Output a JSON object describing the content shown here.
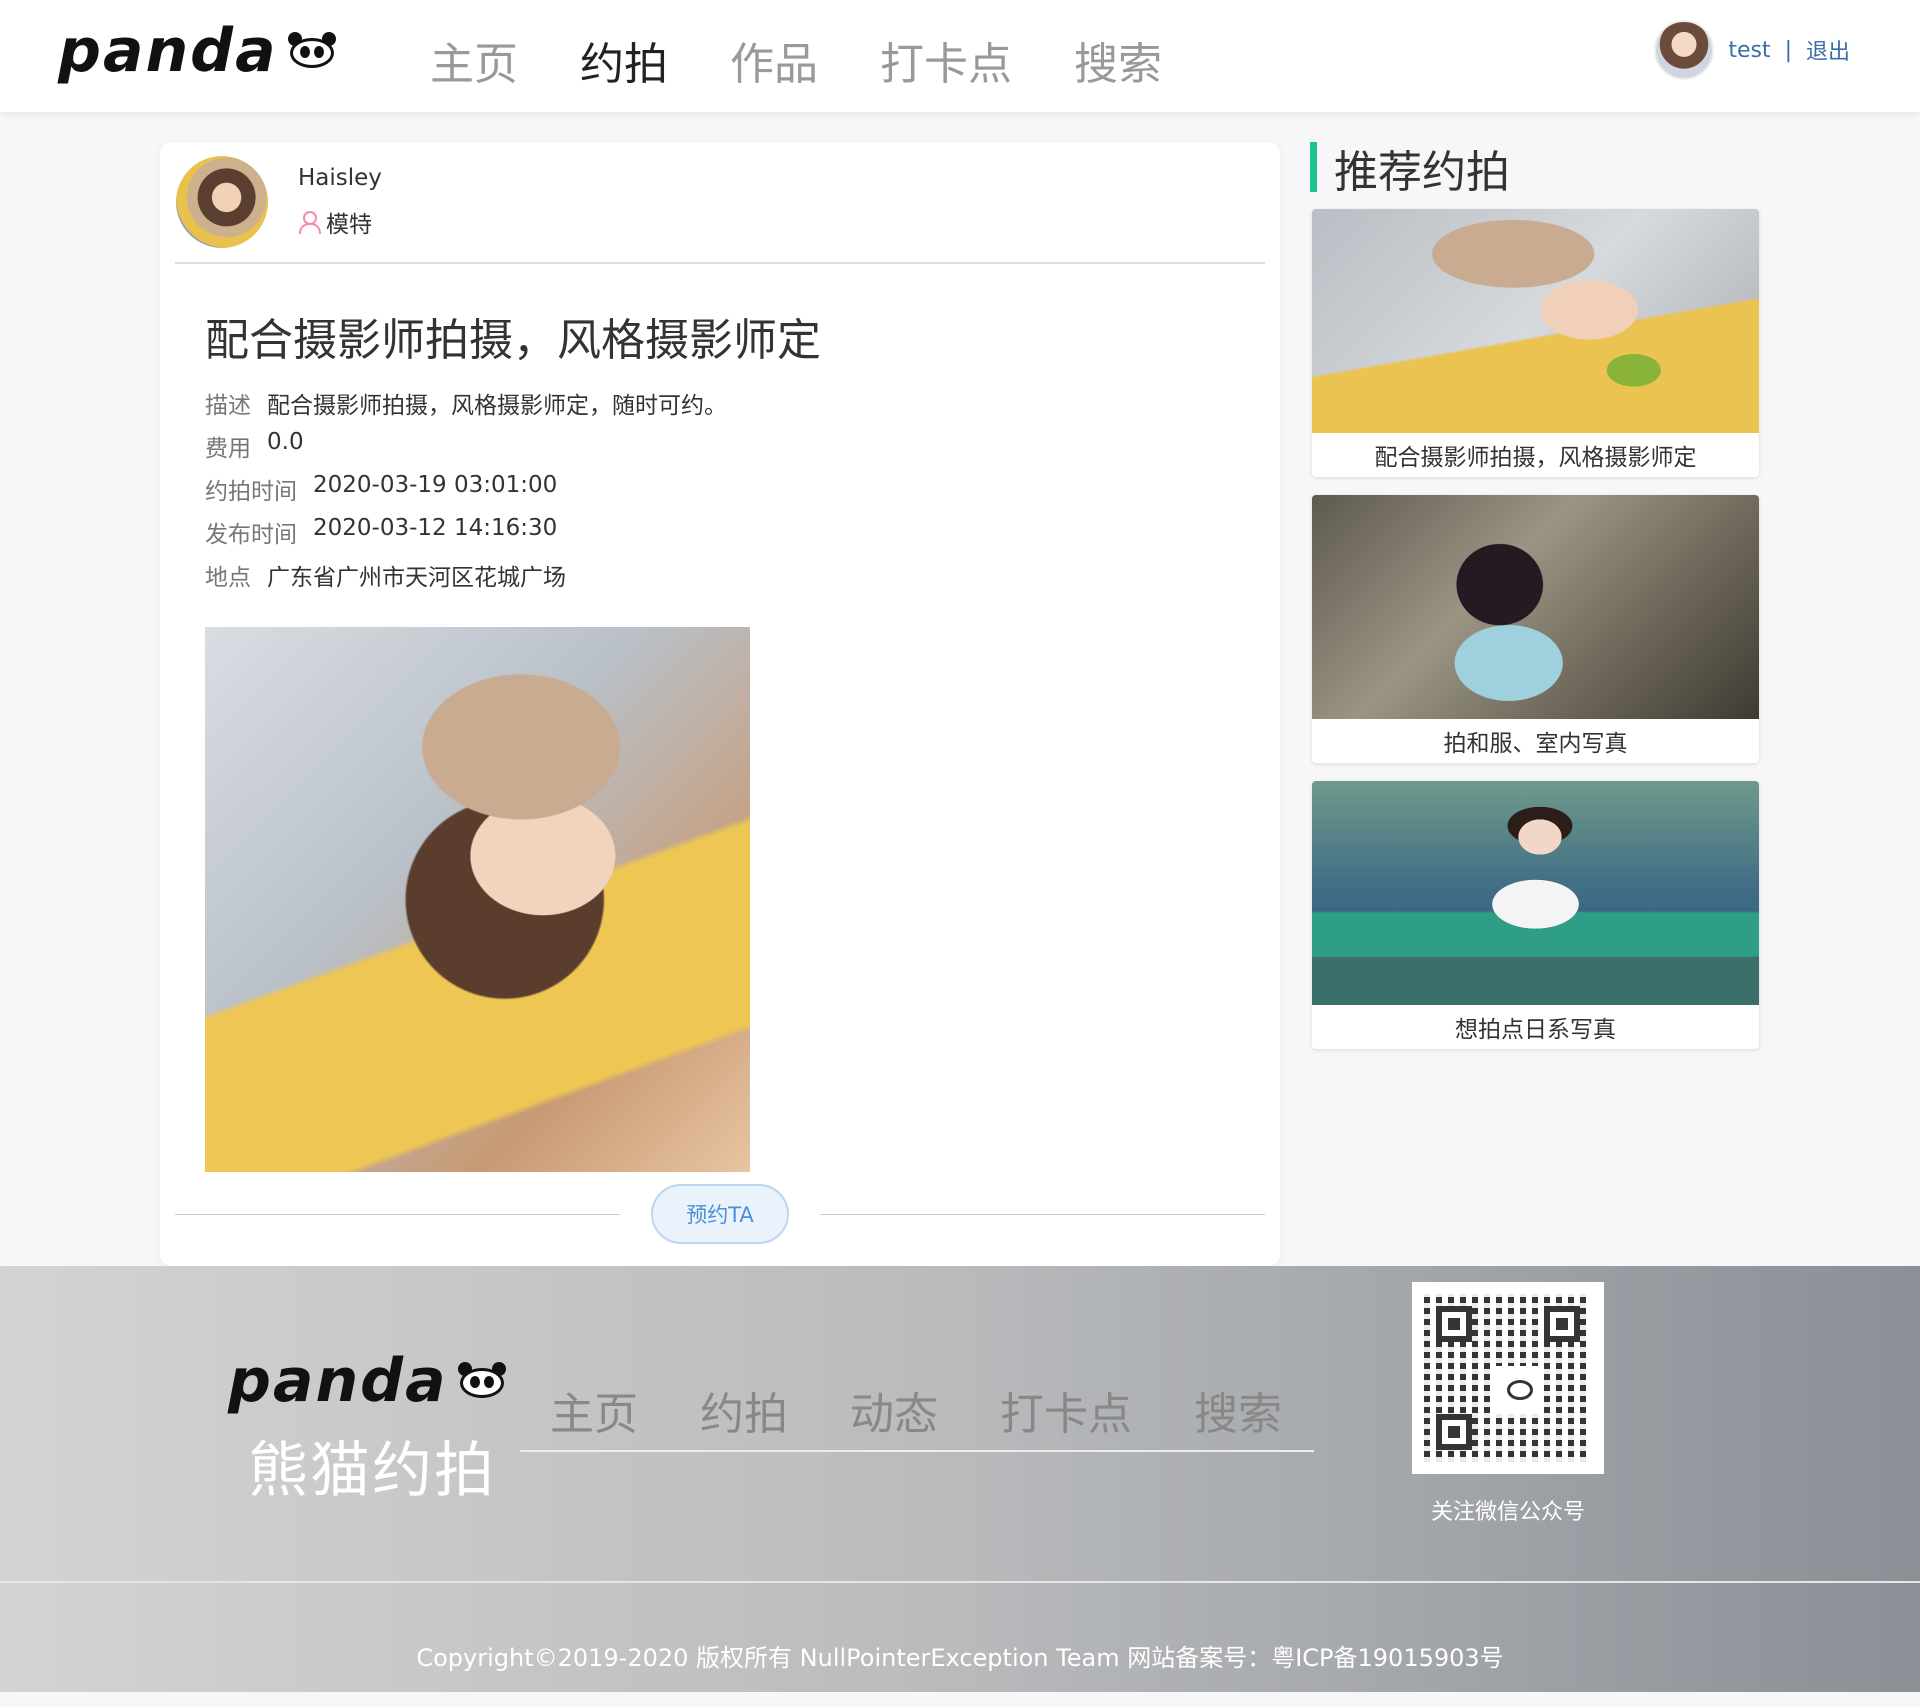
{
  "header": {
    "logo_text": "panda",
    "nav": [
      "主页",
      "约拍",
      "作品",
      "打卡点",
      "搜索"
    ],
    "active_nav": "约拍",
    "user": "test",
    "separator": "|",
    "logout": "退出"
  },
  "post": {
    "author_name": "Haisley",
    "author_role": "模特",
    "title": "配合摄影师拍摄，风格摄影师定",
    "details": [
      {
        "label": "描述",
        "value": "配合摄影师拍摄，风格摄影师定，随时可约。"
      },
      {
        "label": "费用",
        "value": "0.0"
      },
      {
        "label": "约拍时间",
        "value": "2020-03-19 03:01:00"
      },
      {
        "label": "发布时间",
        "value": "2020-03-12 14:16:30"
      },
      {
        "label": "地点",
        "value": "广东省广州市天河区花城广场"
      }
    ],
    "book_button": "预约TA"
  },
  "sidebar": {
    "title": "推荐约拍",
    "items": [
      {
        "label": "配合摄影师拍摄，风格摄影师定"
      },
      {
        "label": "拍和服、室内写真"
      },
      {
        "label": "想拍点日系写真"
      }
    ]
  },
  "footer": {
    "logo_text": "panda",
    "brand_cn": "熊猫约拍",
    "nav": [
      "主页",
      "约拍",
      "动态",
      "打卡点",
      "搜索"
    ],
    "qr_caption": "关注微信公众号",
    "copyright": "Copyright©2019-2020 版权所有 NullPointerException Team 网站备案号：粤ICP备19015903号"
  },
  "colors": {
    "accent_green": "#1bc18f",
    "link_blue": "#3a6fa8",
    "button_blue": "#4a90d9"
  }
}
